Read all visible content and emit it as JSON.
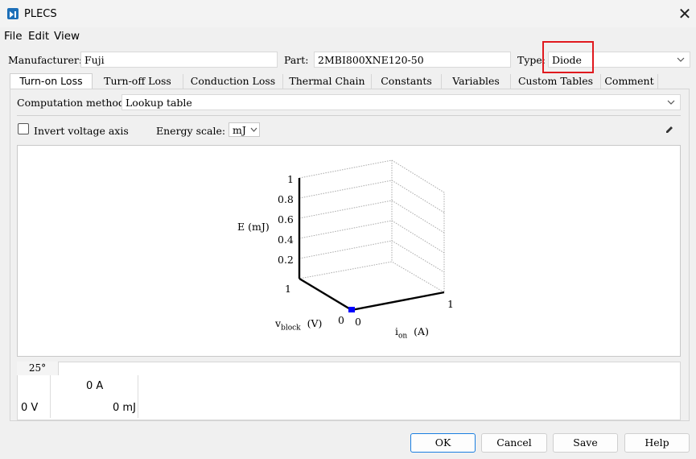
{
  "window": {
    "title": "PLECS",
    "close_glyph": "✕"
  },
  "menu": [
    "File",
    "Edit",
    "View"
  ],
  "header": {
    "manufacturer_label": "Manufacturer:",
    "manufacturer_value": "Fuji",
    "part_label": "Part:",
    "part_value": "2MBI800XNE120-50",
    "type_label": "Type:",
    "type_value": "Diode"
  },
  "tabs": [
    "Turn-on Loss",
    "Turn-off Loss",
    "Conduction Loss",
    "Thermal Chain",
    "Constants",
    "Variables",
    "Custom Tables",
    "Comment"
  ],
  "computation": {
    "label": "Computation method:",
    "value": "Lookup table"
  },
  "options": {
    "invert_label": "Invert voltage axis",
    "energy_scale_label": "Energy scale:",
    "energy_scale_value": "mJ"
  },
  "plot": {
    "z_ticks": [
      "1",
      "0.8",
      "0.6",
      "0.4",
      "0.2"
    ],
    "z_label": "E (mJ)",
    "v_tick_far": "1",
    "v_tick_near": "0",
    "i_tick_near": "0",
    "i_tick_far": "1",
    "v_label_main": "v",
    "v_label_sub": "block",
    "v_label_unit": "(V)",
    "i_label_main": "i",
    "i_label_sub": "on",
    "i_label_unit": "(A)",
    "point_color": "#0000ff"
  },
  "table": {
    "temperature": "25°",
    "current_header": "0 A",
    "voltage_row": "0 V",
    "energy_value": "0 mJ"
  },
  "buttons": {
    "ok": "OK",
    "cancel": "Cancel",
    "save": "Save",
    "help": "Help"
  },
  "colors": {
    "highlight": "#e0191e",
    "accent": "#1a7ee0"
  }
}
